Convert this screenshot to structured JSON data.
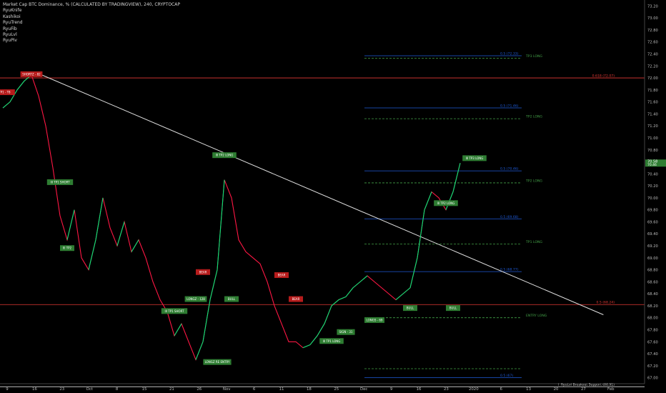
{
  "header": {
    "title": "Market Cap BTC Dominance, % (CALCULATED BY TRADINGVIEW), 240, CRYPTOCAP",
    "indicators": [
      "RyuKnife",
      "Kashikoi",
      "RyuTrend",
      "RyuFib",
      "RyuLvl",
      "RyuPiv"
    ]
  },
  "chart_data": {
    "type": "line",
    "ylim": [
      66.9,
      73.3
    ],
    "x_ticks": [
      "9",
      "16",
      "23",
      "Oct",
      "8",
      "15",
      "21",
      "26",
      "Nov",
      "6",
      "11",
      "18",
      "25",
      "Dec",
      "9",
      "16",
      "23",
      "2020",
      "6",
      "13",
      "20",
      "27",
      "Feb"
    ],
    "y_ticks": [
      "73.20",
      "73.00",
      "72.80",
      "72.60",
      "72.40",
      "72.20",
      "72.00",
      "71.80",
      "71.60",
      "71.40",
      "71.20",
      "71.00",
      "70.80",
      "70.60",
      "70.40",
      "70.20",
      "70.00",
      "69.80",
      "69.60",
      "69.40",
      "69.20",
      "69.00",
      "68.80",
      "68.60",
      "68.40",
      "68.20",
      "68.00",
      "67.80",
      "67.60",
      "67.40",
      "67.20",
      "67.00"
    ],
    "last_price": {
      "value": 70.58,
      "label": "70.58",
      "label2": "70.46",
      "color": "#2e7d32"
    },
    "price": [
      [
        0,
        71.5
      ],
      [
        1,
        71.6
      ],
      [
        2,
        71.8
      ],
      [
        3,
        71.95
      ],
      [
        4,
        72.05
      ],
      [
        5,
        71.7
      ],
      [
        6,
        71.2
      ],
      [
        7,
        70.5
      ],
      [
        8,
        69.7
      ],
      [
        9,
        69.3
      ],
      [
        10,
        69.8
      ],
      [
        11,
        69.0
      ],
      [
        12,
        68.8
      ],
      [
        13,
        69.3
      ],
      [
        14,
        70.0
      ],
      [
        15,
        69.5
      ],
      [
        16,
        69.2
      ],
      [
        17,
        69.6
      ],
      [
        18,
        69.1
      ],
      [
        19,
        69.3
      ],
      [
        20,
        69.0
      ],
      [
        21,
        68.6
      ],
      [
        22,
        68.3
      ],
      [
        23,
        68.1
      ],
      [
        24,
        67.7
      ],
      [
        25,
        67.9
      ],
      [
        26,
        67.6
      ],
      [
        27,
        67.3
      ],
      [
        28,
        67.6
      ],
      [
        29,
        68.3
      ],
      [
        30,
        68.8
      ],
      [
        31,
        70.3
      ],
      [
        32,
        70.0
      ],
      [
        33,
        69.3
      ],
      [
        34,
        69.1
      ],
      [
        35,
        69.0
      ],
      [
        36,
        68.9
      ],
      [
        37,
        68.6
      ],
      [
        38,
        68.2
      ],
      [
        39,
        67.9
      ],
      [
        40,
        67.6
      ],
      [
        41,
        67.6
      ],
      [
        42,
        67.5
      ],
      [
        43,
        67.55
      ],
      [
        44,
        67.7
      ],
      [
        45,
        67.9
      ],
      [
        46,
        68.2
      ],
      [
        47,
        68.3
      ],
      [
        48,
        68.35
      ],
      [
        49,
        68.5
      ],
      [
        50,
        68.6
      ],
      [
        51,
        68.7
      ],
      [
        52,
        68.6
      ],
      [
        53,
        68.5
      ],
      [
        54,
        68.4
      ],
      [
        55,
        68.3
      ],
      [
        56,
        68.4
      ],
      [
        57,
        68.5
      ],
      [
        58,
        69.0
      ],
      [
        59,
        69.8
      ],
      [
        60,
        70.1
      ],
      [
        61,
        70.0
      ],
      [
        62,
        69.8
      ],
      [
        63,
        70.1
      ],
      [
        64,
        70.58
      ]
    ],
    "trendline": {
      "start": [
        4,
        72.05
      ],
      "end": [
        66,
        68.05
      ]
    },
    "horizontal_levels": [
      {
        "value": 72.0,
        "label": "0.618 (72.07)",
        "color": "#e53935",
        "style": "solid",
        "full": true
      },
      {
        "value": 68.22,
        "label": "0.5 (68.24)",
        "color": "#e53935",
        "style": "solid",
        "full": true
      },
      {
        "value": 66.85,
        "label": "↑ RyuLvl Breakout Support (66.91)",
        "color": "#dddddd",
        "style": "solid",
        "full": true
      },
      {
        "value": 72.37,
        "label": "0.5 (72.33)",
        "color": "#1e5ad8",
        "style": "solid"
      },
      {
        "value": 71.5,
        "label": "0.5 (71.46)",
        "color": "#1e5ad8",
        "style": "solid"
      },
      {
        "value": 70.45,
        "label": "0.5 (70.46)",
        "color": "#1e5ad8",
        "style": "solid"
      },
      {
        "value": 69.65,
        "label": "0.5 (69.68)",
        "color": "#1e5ad8",
        "style": "solid"
      },
      {
        "value": 68.77,
        "label": "0.5 (68.77)",
        "color": "#1e5ad8",
        "style": "solid"
      },
      {
        "value": 67.0,
        "label": "0.5 (67)",
        "color": "#1e5ad8",
        "style": "solid"
      },
      {
        "value": 72.33,
        "label": "TP3 LONG",
        "color": "#43a047",
        "style": "dashed"
      },
      {
        "value": 71.32,
        "label": "TP2 LONG",
        "color": "#43a047",
        "style": "dashed"
      },
      {
        "value": 70.25,
        "label": "TP2 LONG",
        "color": "#43a047",
        "style": "dashed"
      },
      {
        "value": 69.23,
        "label": "TP1 LONG",
        "color": "#43a047",
        "style": "dashed"
      },
      {
        "value": 68.0,
        "label": "ENTRY LONG",
        "color": "#43a047",
        "style": "dashed"
      },
      {
        "value": 67.15,
        "label": "",
        "color": "#43a047",
        "style": "dashed"
      }
    ],
    "annotations": [
      {
        "text": "SHORTZ - 82",
        "x": 4,
        "y": 72.05,
        "color": "#b71c1c"
      },
      {
        "text": "III TP1 - T8",
        "x": 0,
        "y": 71.75,
        "color": "#b71c1c"
      },
      {
        "text": "III TP1 SHORT",
        "x": 8,
        "y": 70.25,
        "color": "#2e7d32"
      },
      {
        "text": "III TP2",
        "x": 9,
        "y": 69.15,
        "color": "#2e7d32"
      },
      {
        "text": "III TP1 SHORT",
        "x": 24,
        "y": 68.1,
        "color": "#2e7d32"
      },
      {
        "text": "LONGZ - 128",
        "x": 27,
        "y": 68.3,
        "color": "#2e7d32"
      },
      {
        "text": "III TP2 LONG",
        "x": 31,
        "y": 70.7,
        "color": "#2e7d32"
      },
      {
        "text": "LONGZ RE ENTRY",
        "x": 30,
        "y": 67.25,
        "color": "#2e7d32"
      },
      {
        "text": "BULL",
        "x": 32,
        "y": 68.3,
        "color": "#2e7d32"
      },
      {
        "text": "BEAR",
        "x": 28,
        "y": 68.75,
        "color": "#b71c1c"
      },
      {
        "text": "BEAR",
        "x": 39,
        "y": 68.7,
        "color": "#b71c1c"
      },
      {
        "text": "BEAR",
        "x": 41,
        "y": 68.3,
        "color": "#b71c1c"
      },
      {
        "text": "III TP1 LONG",
        "x": 46,
        "y": 67.6,
        "color": "#2e7d32"
      },
      {
        "text": "SIGN - 31",
        "x": 48,
        "y": 67.75,
        "color": "#2e7d32"
      },
      {
        "text": "LONGS - 69",
        "x": 52,
        "y": 67.95,
        "color": "#2e7d32"
      },
      {
        "text": "BULL",
        "x": 57,
        "y": 68.15,
        "color": "#2e7d32"
      },
      {
        "text": "BULL",
        "x": 63,
        "y": 68.15,
        "color": "#2e7d32"
      },
      {
        "text": "III TP2 LONG",
        "x": 62,
        "y": 69.9,
        "color": "#2e7d32"
      },
      {
        "text": "III TP3 LONG",
        "x": 66,
        "y": 70.65,
        "color": "#2e7d32"
      }
    ]
  }
}
